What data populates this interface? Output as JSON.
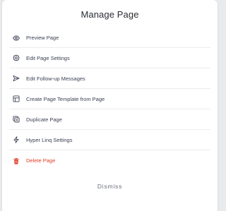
{
  "dialog": {
    "title": "Manage Page",
    "items": [
      {
        "label": "Preview Page",
        "icon": "eye-icon"
      },
      {
        "label": "Edit Page Settings",
        "icon": "gear-icon"
      },
      {
        "label": "Edit Follow-up Messages",
        "icon": "send-icon"
      },
      {
        "label": "Create Page Template from Page",
        "icon": "layout-icon"
      },
      {
        "label": "Duplicate Page",
        "icon": "duplicate-icon"
      },
      {
        "label": "Hyper Linq Settings",
        "icon": "lightning-icon"
      },
      {
        "label": "Delete Page",
        "icon": "trash-icon"
      }
    ],
    "dismiss_label": "Dismiss"
  },
  "colors": {
    "text": "#3a3f52",
    "danger": "#e03b2a",
    "divider": "#ececf0"
  }
}
